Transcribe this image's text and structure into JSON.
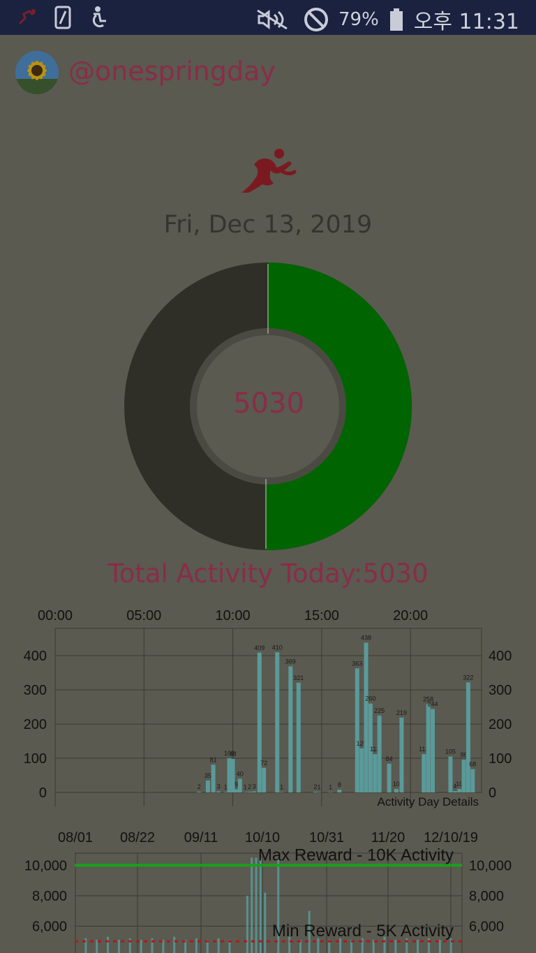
{
  "status_bar": {
    "battery": "79%",
    "time": "오후 11:31",
    "icons": [
      "app-runner-icon",
      "phone-icon",
      "accessibility-icon",
      "mute-icon",
      "do-not-disturb-icon",
      "battery-icon"
    ]
  },
  "profile": {
    "username": "@onespringday"
  },
  "date": "Fri, Dec 13, 2019",
  "ring": {
    "center_value": "5030",
    "progress": 0.503,
    "colors": {
      "done": "#006400",
      "rest": "#2f2f28"
    }
  },
  "total_label": "Total Activity Today:5030",
  "chart_data": [
    {
      "type": "bar",
      "title": "Activity Day Details",
      "x_ticks": [
        "00:00",
        "05:00",
        "10:00",
        "15:00",
        "20:00"
      ],
      "y_ticks": [
        "0",
        "100",
        "200",
        "300",
        "400"
      ],
      "ylim": [
        0,
        480
      ],
      "xlim_hours": [
        0,
        24
      ],
      "grid": true,
      "bar_color": "#5a9a9a",
      "points": [
        {
          "x": 8.1,
          "y": 2,
          "label": "2"
        },
        {
          "x": 8.6,
          "y": 35,
          "label": "35"
        },
        {
          "x": 8.9,
          "y": 81,
          "label": "81"
        },
        {
          "x": 9.2,
          "y": 3,
          "label": "3"
        },
        {
          "x": 9.6,
          "y": 1,
          "label": "1"
        },
        {
          "x": 9.8,
          "y": 100,
          "label": "100"
        },
        {
          "x": 10.0,
          "y": 98,
          "label": "98"
        },
        {
          "x": 10.2,
          "y": 9,
          "label": "9"
        },
        {
          "x": 10.4,
          "y": 40,
          "label": "40"
        },
        {
          "x": 10.7,
          "y": 1,
          "label": "1"
        },
        {
          "x": 10.95,
          "y": 2,
          "label": "2"
        },
        {
          "x": 11.2,
          "y": 3,
          "label": "3"
        },
        {
          "x": 11.5,
          "y": 409,
          "label": "409"
        },
        {
          "x": 11.75,
          "y": 72,
          "label": "72"
        },
        {
          "x": 12.5,
          "y": 410,
          "label": "410"
        },
        {
          "x": 12.75,
          "y": 1,
          "label": "1"
        },
        {
          "x": 13.25,
          "y": 369,
          "label": "369"
        },
        {
          "x": 13.7,
          "y": 321,
          "label": "321"
        },
        {
          "x": 14.65,
          "y": 2,
          "label": "2"
        },
        {
          "x": 14.85,
          "y": 1,
          "label": "1"
        },
        {
          "x": 15.5,
          "y": 1,
          "label": "1"
        },
        {
          "x": 16.0,
          "y": 8,
          "label": "8"
        },
        {
          "x": 17.0,
          "y": 363,
          "label": "363"
        },
        {
          "x": 17.25,
          "y": 129,
          "label": "129"
        },
        {
          "x": 17.5,
          "y": 438,
          "label": "438"
        },
        {
          "x": 17.75,
          "y": 260,
          "label": "260"
        },
        {
          "x": 18.0,
          "y": 112,
          "label": "112"
        },
        {
          "x": 18.25,
          "y": 225,
          "label": "225"
        },
        {
          "x": 18.8,
          "y": 84,
          "label": "84"
        },
        {
          "x": 19.2,
          "y": 10,
          "label": "10"
        },
        {
          "x": 19.5,
          "y": 219,
          "label": "219"
        },
        {
          "x": 20.75,
          "y": 112,
          "label": "112"
        },
        {
          "x": 21.0,
          "y": 258,
          "label": "258"
        },
        {
          "x": 21.25,
          "y": 244,
          "label": "244"
        },
        {
          "x": 22.25,
          "y": 105,
          "label": "105"
        },
        {
          "x": 22.5,
          "y": 4,
          "label": "4"
        },
        {
          "x": 22.75,
          "y": 10,
          "label": "10"
        },
        {
          "x": 23.0,
          "y": 96,
          "label": "96"
        },
        {
          "x": 23.25,
          "y": 322,
          "label": "322"
        },
        {
          "x": 23.5,
          "y": 68,
          "label": "68"
        }
      ]
    },
    {
      "type": "bar",
      "x_ticks": [
        "08/01",
        "08/22",
        "09/11",
        "10/10",
        "10/31",
        "11/20",
        "12/10/19"
      ],
      "y_ticks": [
        "6,000",
        "8,000",
        "10,000"
      ],
      "ylim": [
        4000,
        10800
      ],
      "grid": true,
      "bar_color": "#5a9a9a",
      "reference_lines": [
        {
          "label": "Max Reward - 10K Activity",
          "value": 10000,
          "color": "#1aa01a",
          "style": "solid"
        },
        {
          "label": "Min Reward - 5K Activity",
          "value": 5000,
          "color": "#b01818",
          "style": "dashed"
        }
      ],
      "bars": [
        {
          "x": 0.78,
          "y": 8000
        },
        {
          "x": 0.8,
          "y": 10500
        },
        {
          "x": 0.82,
          "y": 10500
        },
        {
          "x": 0.84,
          "y": 10500
        },
        {
          "x": 0.86,
          "y": 8200
        },
        {
          "x": 0.92,
          "y": 10500
        },
        {
          "x": 1.06,
          "y": 7000
        },
        {
          "x": 0.05,
          "y": 5200
        },
        {
          "x": 0.1,
          "y": 5100
        },
        {
          "x": 0.15,
          "y": 5300
        },
        {
          "x": 0.2,
          "y": 5100
        },
        {
          "x": 0.25,
          "y": 5200
        },
        {
          "x": 0.3,
          "y": 5100
        },
        {
          "x": 0.35,
          "y": 5200
        },
        {
          "x": 0.4,
          "y": 5100
        },
        {
          "x": 0.45,
          "y": 5300
        },
        {
          "x": 0.5,
          "y": 5100
        },
        {
          "x": 0.55,
          "y": 5200
        },
        {
          "x": 0.6,
          "y": 5100
        },
        {
          "x": 0.65,
          "y": 5200
        },
        {
          "x": 0.7,
          "y": 5100
        },
        {
          "x": 0.97,
          "y": 5300
        },
        {
          "x": 1.02,
          "y": 5100
        },
        {
          "x": 1.1,
          "y": 5200
        },
        {
          "x": 1.15,
          "y": 5100
        },
        {
          "x": 1.2,
          "y": 5200
        },
        {
          "x": 1.25,
          "y": 5100
        },
        {
          "x": 1.3,
          "y": 5200
        },
        {
          "x": 1.35,
          "y": 5100
        },
        {
          "x": 1.4,
          "y": 5300
        },
        {
          "x": 1.45,
          "y": 5100
        },
        {
          "x": 1.5,
          "y": 5200
        },
        {
          "x": 1.55,
          "y": 5100
        },
        {
          "x": 1.6,
          "y": 5200
        },
        {
          "x": 1.65,
          "y": 5100
        },
        {
          "x": 1.7,
          "y": 5200
        }
      ]
    }
  ]
}
